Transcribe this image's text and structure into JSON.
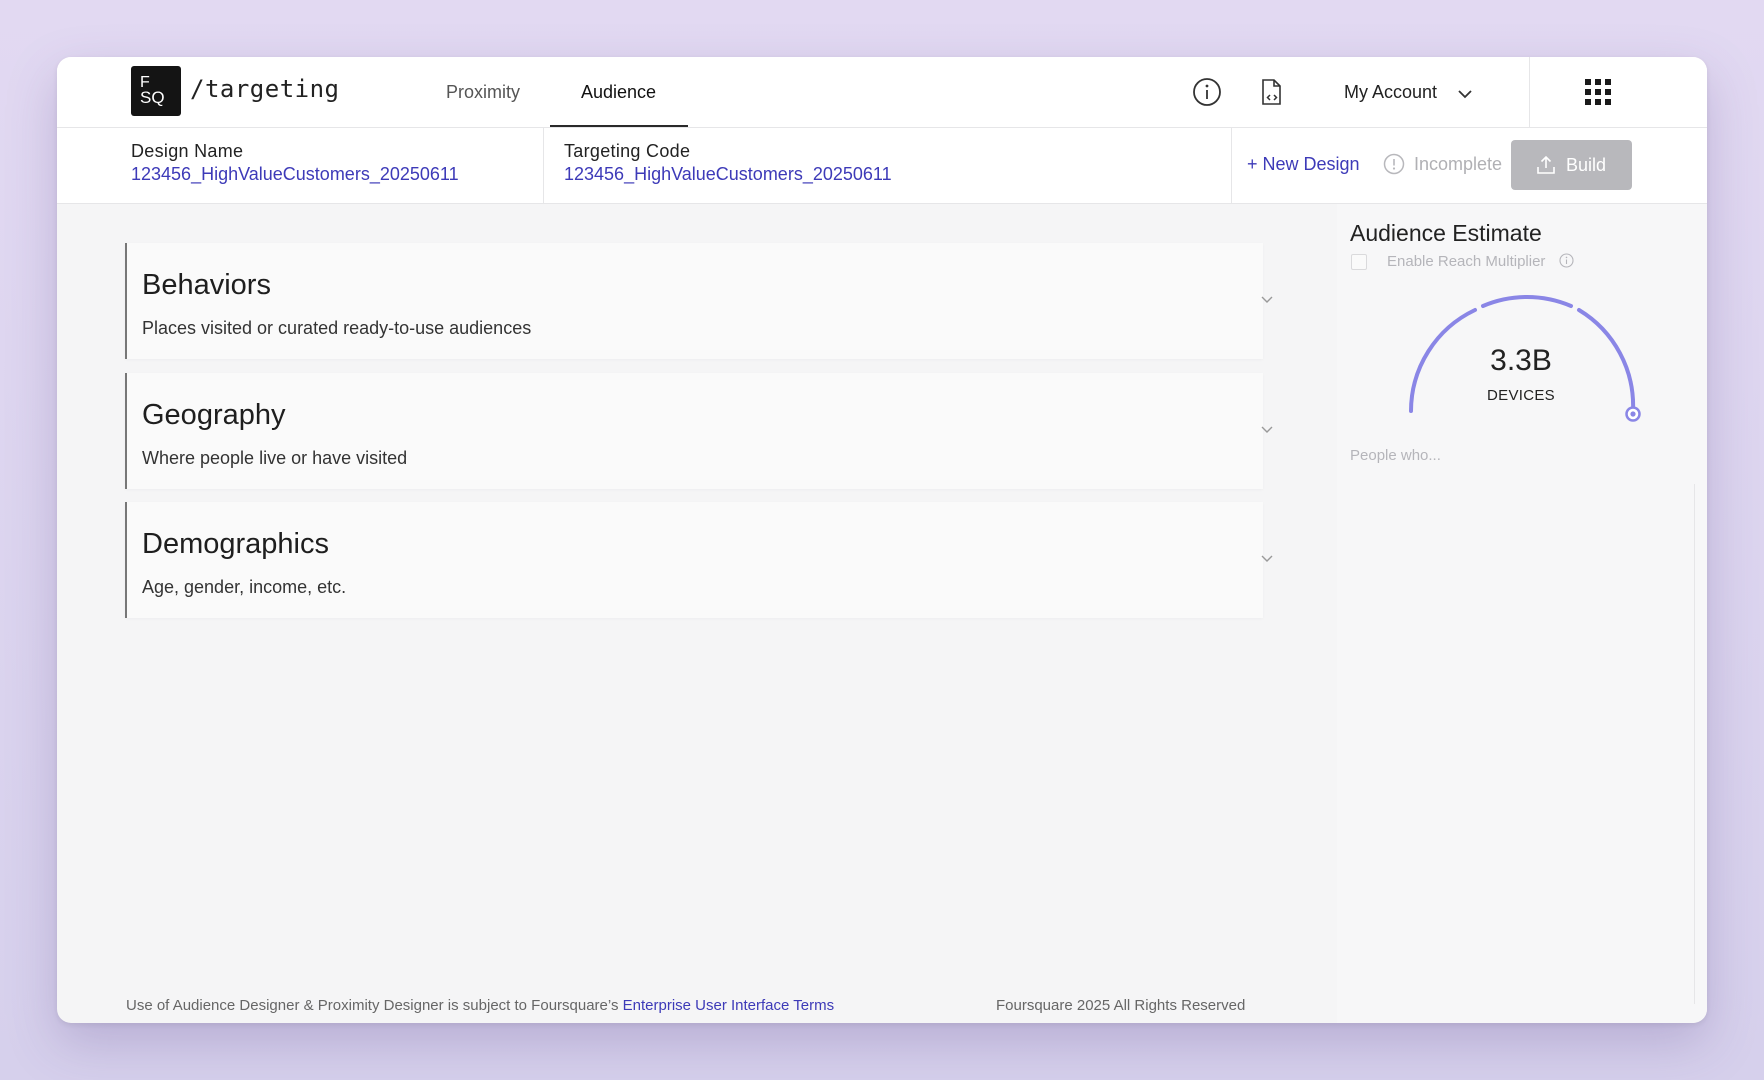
{
  "header": {
    "logo_top": "F",
    "logo_bottom": "SQ",
    "brand": "/targeting",
    "tabs": [
      {
        "label": "Proximity",
        "active": false
      },
      {
        "label": "Audience",
        "active": true
      }
    ],
    "account_label": "My Account"
  },
  "design": {
    "design_name_label": "Design Name",
    "design_name_value": "123456_HighValueCustomers_20250611",
    "targeting_code_label": "Targeting Code",
    "targeting_code_value": "123456_HighValueCustomers_20250611",
    "new_design_label": "+ New Design",
    "status_label": "Incomplete",
    "build_label": "Build"
  },
  "sections": [
    {
      "title": "Behaviors",
      "description": "Places visited or curated ready-to-use audiences"
    },
    {
      "title": "Geography",
      "description": "Where people live or have visited"
    },
    {
      "title": "Demographics",
      "description": "Age, gender, income, etc."
    }
  ],
  "estimate": {
    "title": "Audience Estimate",
    "reach_multiplier_label": "Enable Reach Multiplier",
    "reach_multiplier_checked": false,
    "value": "3.3B",
    "unit": "DEVICES",
    "people_placeholder": "People who..."
  },
  "footer": {
    "terms_prefix": "Use of Audience Designer & Proximity Designer is subject to Foursquare’s ",
    "terms_link": "Enterprise User Interface Terms",
    "copyright": "Foursquare 2025 All Rights Reserved"
  },
  "colors": {
    "accent": "#3d3ab8",
    "gauge": "#8a86e6",
    "build_disabled": "#b8b8bc"
  }
}
